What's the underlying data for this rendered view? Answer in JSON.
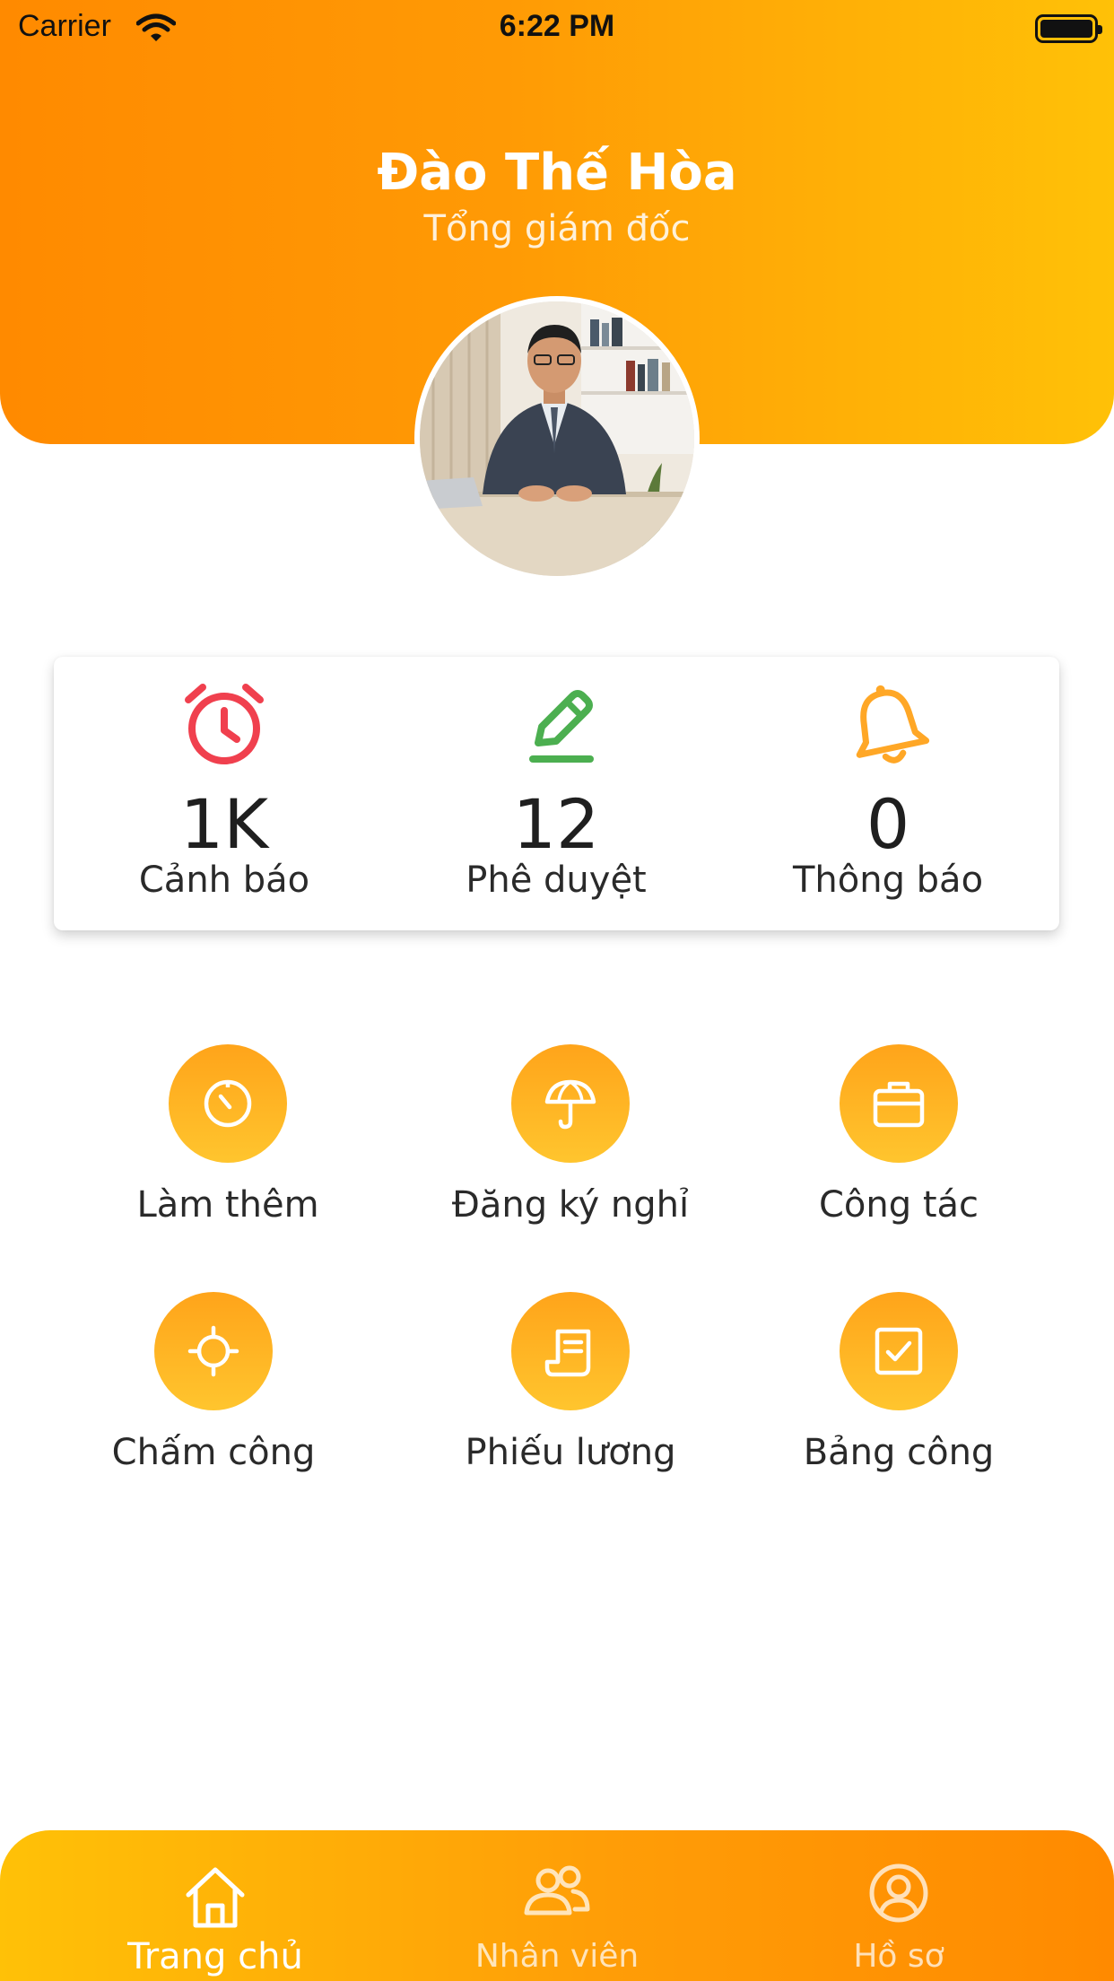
{
  "status_bar": {
    "carrier": "Carrier",
    "time": "6:22 PM"
  },
  "profile": {
    "name": "Đào Thế Hòa",
    "role": "Tổng giám đốc"
  },
  "stats": [
    {
      "value": "1K",
      "label": "Cảnh báo",
      "icon": "alarm-clock-icon",
      "color": "#f0404e"
    },
    {
      "value": "12",
      "label": "Phê duyệt",
      "icon": "pencil-icon",
      "color": "#4caf50"
    },
    {
      "value": "0",
      "label": "Thông báo",
      "icon": "bell-icon",
      "color": "#ffa726"
    }
  ],
  "features": [
    {
      "label": "Làm thêm",
      "icon": "timer-icon"
    },
    {
      "label": "Đăng ký nghỉ",
      "icon": "umbrella-icon"
    },
    {
      "label": "Công tác",
      "icon": "briefcase-icon"
    },
    {
      "label": "Chấm công",
      "icon": "crosshair-icon"
    },
    {
      "label": "Phiếu lương",
      "icon": "receipt-icon"
    },
    {
      "label": "Bảng công",
      "icon": "checkbox-icon"
    }
  ],
  "bottom_nav": [
    {
      "label": "Trang chủ",
      "icon": "home-icon",
      "active": true
    },
    {
      "label": "Nhân viên",
      "icon": "people-icon",
      "active": false
    },
    {
      "label": "Hồ sơ",
      "icon": "profile-icon",
      "active": false
    }
  ],
  "colors": {
    "header_gradient": [
      "#ff8a00",
      "#ffc107"
    ],
    "feature_gradient": [
      "#ffa41a",
      "#ffc52e"
    ]
  }
}
